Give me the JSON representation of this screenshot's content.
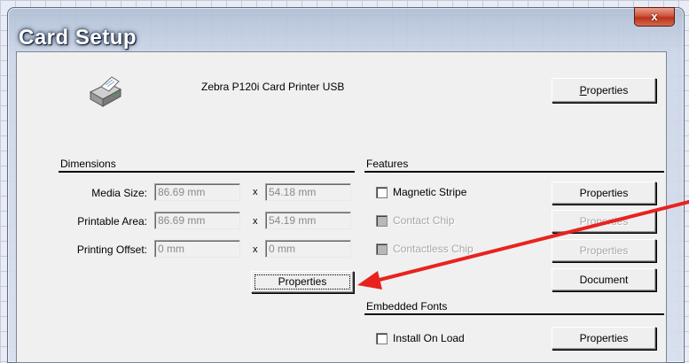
{
  "window": {
    "title": "Card Setup",
    "close_glyph": "x"
  },
  "printer": {
    "name": "Zebra P120i Card Printer USB",
    "properties_button": {
      "mnemonic": "P",
      "rest": "roperties"
    }
  },
  "dimensions": {
    "heading": "Dimensions",
    "separator": "x",
    "rows": [
      {
        "label": "Media Size:",
        "width": "86.69 mm",
        "height": "54.18 mm"
      },
      {
        "label": "Printable Area:",
        "width": "86.69 mm",
        "height": "54.19 mm"
      },
      {
        "label": "Printing Offset:",
        "width": "0 mm",
        "height": "0 mm"
      }
    ],
    "properties_button": "Properties"
  },
  "features": {
    "heading": "Features",
    "items": [
      {
        "label": "Magnetic Stripe",
        "checked": false,
        "enabled": true,
        "button": "Properties"
      },
      {
        "label": "Contact Chip",
        "checked": false,
        "enabled": false,
        "button": "Properties"
      },
      {
        "label": "Contactless Chip",
        "checked": false,
        "enabled": false,
        "button": "Properties"
      }
    ],
    "document_button": "Document"
  },
  "embedded_fonts": {
    "heading": "Embedded Fonts",
    "install_label": "Install On Load",
    "install_checked": false,
    "properties_button": "Properties"
  },
  "colors": {
    "annotation_arrow": "#e8231e"
  },
  "annotation": {
    "icon": "red-arrow-icon"
  }
}
